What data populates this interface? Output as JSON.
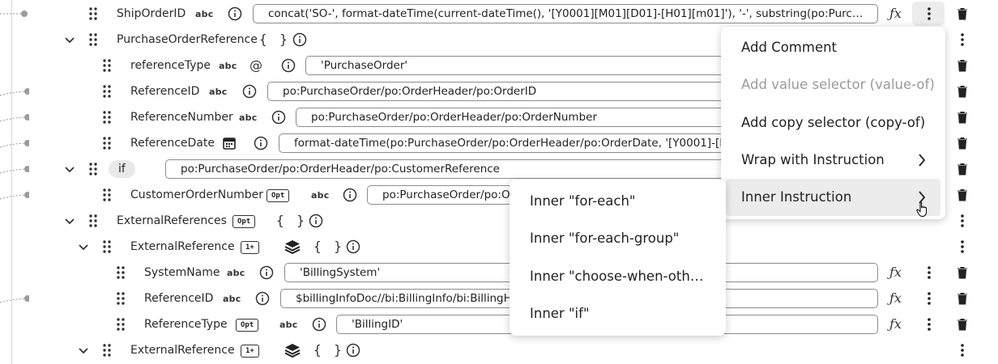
{
  "rows": [
    {
      "name": "ShipOrderID",
      "type": "abc",
      "expr": "concat('SO-', format-dateTime(current-dateTime(), '[Y0001][M01][D01]-[H01][m01]'), '-', substring(po:PurchaseOr…"
    },
    {
      "name": "PurchaseOrderReference",
      "braces": "{ }"
    },
    {
      "name": "referenceType",
      "type": "abc",
      "attr": "@",
      "expr": "'PurchaseOrder'"
    },
    {
      "name": "ReferenceID",
      "type": "abc",
      "expr": "po:PurchaseOrder/po:OrderHeader/po:OrderID"
    },
    {
      "name": "ReferenceNumber",
      "type": "abc",
      "expr": "po:PurchaseOrder/po:OrderHeader/po:OrderNumber"
    },
    {
      "name": "ReferenceDate",
      "expr": "format-dateTime(po:PurchaseOrder/po:OrderHeader/po:OrderDate, '[Y0001]-[M01]-"
    },
    {
      "name": "if",
      "expr": "po:PurchaseOrder/po:OrderHeader/po:CustomerReference"
    },
    {
      "name": "CustomerOrderNumber",
      "badge": "Opt",
      "type": "abc",
      "expr": "po:PurchaseOrder/po:Ord"
    },
    {
      "name": "ExternalReferences",
      "badge": "Opt",
      "braces": "{ }"
    },
    {
      "name": "ExternalReference",
      "badge": "1+",
      "braces": "{ }"
    },
    {
      "name": "SystemName",
      "type": "abc",
      "expr": "'BillingSystem'"
    },
    {
      "name": "ReferenceID",
      "type": "abc",
      "expr": "$billingInfoDoc//bi:BillingInfo/bi:BillingHe"
    },
    {
      "name": "ReferenceType",
      "badge": "Opt",
      "type": "abc",
      "expr": "'BillingID'"
    },
    {
      "name": "ExternalReference",
      "badge": "1+",
      "braces": "{ }"
    }
  ],
  "context_menu": {
    "items": [
      {
        "label": "Add Comment",
        "disabled": false
      },
      {
        "label": "Add value selector (value-of)",
        "disabled": true
      },
      {
        "label": "Add copy selector (copy-of)",
        "disabled": false
      },
      {
        "label": "Wrap with Instruction",
        "disabled": false,
        "submenu": true
      },
      {
        "label": "Inner Instruction",
        "disabled": false,
        "submenu": true,
        "active": true
      }
    ]
  },
  "submenu": {
    "items": [
      {
        "label": "Inner \"for-each\""
      },
      {
        "label": "Inner \"for-each-group\""
      },
      {
        "label": "Inner \"choose-when-oth…"
      },
      {
        "label": "Inner \"if\""
      }
    ]
  },
  "icons": {
    "drag": "drag-handle-icon",
    "chevron": "chevron-down-icon",
    "info": "info-icon",
    "fx": "function-icon",
    "kebab": "more-vertical-icon",
    "trash": "trash-icon",
    "calendar": "calendar-icon",
    "layers": "layers-icon",
    "arrow": "chevron-right-icon",
    "cursor": "mouse-pointer-icon"
  },
  "colors": {
    "menu_active": "#ececec",
    "disabled_text": "#9a9a9a",
    "guide_line": "#d7d7d7"
  }
}
